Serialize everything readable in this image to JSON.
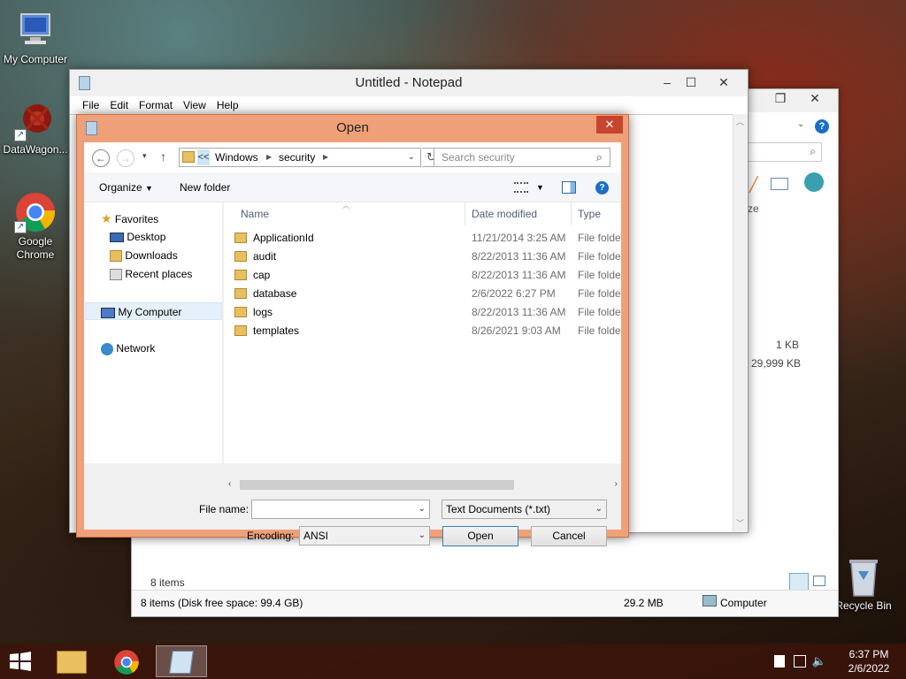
{
  "desktop": {
    "icons": [
      {
        "label": "My Computer"
      },
      {
        "label": "DataWagon..."
      },
      {
        "label": "Google Chrome"
      },
      {
        "label": "Recycle Bin"
      }
    ]
  },
  "explorer": {
    "column_partial": "ze",
    "sizes": [
      "1 KB",
      "29,999 KB"
    ],
    "items_count": "8 items",
    "status_left": "8 items (Disk free space: 99.4 GB)",
    "status_size": "29.2 MB",
    "status_location": "Computer"
  },
  "notepad": {
    "title": "Untitled - Notepad",
    "menu": [
      "File",
      "Edit",
      "Format",
      "View",
      "Help"
    ]
  },
  "dialog": {
    "title": "Open",
    "breadcrumb": {
      "overflow": "<<",
      "segments": [
        "Windows",
        "security"
      ]
    },
    "search_placeholder": "Search security",
    "toolbar": {
      "organize": "Organize",
      "new_folder": "New folder"
    },
    "nav": {
      "favorites": "Favorites",
      "favorites_items": [
        "Desktop",
        "Downloads",
        "Recent places"
      ],
      "computer": "My Computer",
      "network": "Network"
    },
    "columns": {
      "name": "Name",
      "date": "Date modified",
      "type": "Type"
    },
    "files": [
      {
        "name": "ApplicationId",
        "date": "11/21/2014 3:25 AM",
        "type": "File folder"
      },
      {
        "name": "audit",
        "date": "8/22/2013 11:36 AM",
        "type": "File folder"
      },
      {
        "name": "cap",
        "date": "8/22/2013 11:36 AM",
        "type": "File folder"
      },
      {
        "name": "database",
        "date": "2/6/2022 6:27 PM",
        "type": "File folder"
      },
      {
        "name": "logs",
        "date": "8/22/2013 11:36 AM",
        "type": "File folder"
      },
      {
        "name": "templates",
        "date": "8/26/2021 9:03 AM",
        "type": "File folder"
      }
    ],
    "file_name_label": "File name:",
    "file_name_value": "",
    "file_type": "Text Documents (*.txt)",
    "encoding_label": "Encoding:",
    "encoding_value": "ANSI",
    "open_button": "Open",
    "cancel_button": "Cancel"
  },
  "taskbar": {
    "time": "6:37 PM",
    "date": "2/6/2022"
  },
  "colors": {
    "dialog_frame": "#f0a078",
    "close_red": "#c7442e",
    "header_text": "#4c607a"
  }
}
